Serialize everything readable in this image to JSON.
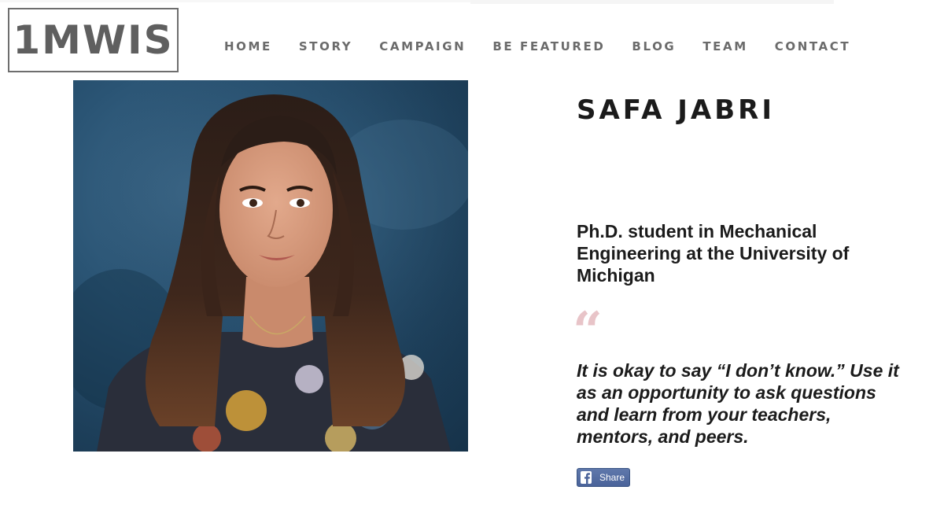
{
  "logo": {
    "text": "1MWIS"
  },
  "nav": {
    "items": [
      {
        "label": "HOME"
      },
      {
        "label": "STORY"
      },
      {
        "label": "CAMPAIGN"
      },
      {
        "label": "BE FEATURED"
      },
      {
        "label": "BLOG"
      },
      {
        "label": "TEAM"
      },
      {
        "label": "CONTACT"
      }
    ]
  },
  "profile": {
    "name": "SAFA JABRI",
    "title": "Ph.D. student in Mechanical Engineering at the University of Michigan",
    "quote_mark": "“",
    "quote": "It is okay to say “I don’t know.” Use it as an opportunity to ask questions and learn from your teachers, mentors, and peers."
  },
  "share": {
    "label": "Share",
    "icon": "facebook-icon"
  },
  "colors": {
    "nav_text": "#6b6b6b",
    "logo": "#5f5f5f",
    "quote_mark": "#e8c4c8",
    "share_bg": "#4a639a",
    "photo_bg": "#1d3f5a"
  }
}
